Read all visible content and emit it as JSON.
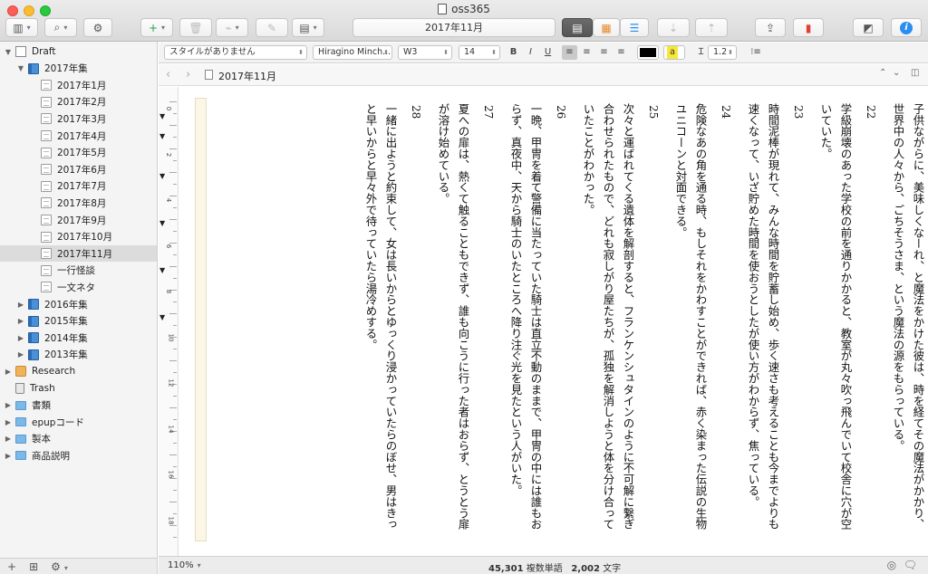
{
  "window": {
    "title": "oss365"
  },
  "toolbar": {
    "document_title": "2017年11月",
    "colors": {
      "selected_view": "#5f5f5f",
      "bookmark": "#e0403a",
      "info": "#2a8ef0"
    }
  },
  "format_bar": {
    "style": "スタイルがありません",
    "font": "Hiragino Minch...",
    "weight": "W3",
    "size": "14",
    "bold": "B",
    "italic": "I",
    "underline": "U",
    "highlight": "a",
    "line_spacing": "1.2",
    "text_color": "#000000",
    "highlight_color": "#f5e83a"
  },
  "path_bar": {
    "title": "2017年11月"
  },
  "binder": {
    "items": [
      {
        "label": "Draft",
        "kind": "draft",
        "level": 0,
        "expanded": true
      },
      {
        "label": "2017年集",
        "kind": "book",
        "level": 1,
        "expanded": true
      },
      {
        "label": "2017年1月",
        "kind": "doc",
        "level": 2
      },
      {
        "label": "2017年2月",
        "kind": "doc",
        "level": 2
      },
      {
        "label": "2017年3月",
        "kind": "doc",
        "level": 2
      },
      {
        "label": "2017年4月",
        "kind": "doc",
        "level": 2
      },
      {
        "label": "2017年5月",
        "kind": "doc",
        "level": 2
      },
      {
        "label": "2017年6月",
        "kind": "doc",
        "level": 2
      },
      {
        "label": "2017年7月",
        "kind": "doc",
        "level": 2
      },
      {
        "label": "2017年8月",
        "kind": "doc",
        "level": 2
      },
      {
        "label": "2017年9月",
        "kind": "doc",
        "level": 2
      },
      {
        "label": "2017年10月",
        "kind": "doc",
        "level": 2
      },
      {
        "label": "2017年11月",
        "kind": "doc",
        "level": 2,
        "selected": true
      },
      {
        "label": "一行怪談",
        "kind": "doc",
        "level": 2
      },
      {
        "label": "一文ネタ",
        "kind": "doc",
        "level": 2
      },
      {
        "label": "2016年集",
        "kind": "book",
        "level": 1,
        "expanded": false
      },
      {
        "label": "2015年集",
        "kind": "book",
        "level": 1,
        "expanded": false
      },
      {
        "label": "2014年集",
        "kind": "book",
        "level": 1,
        "expanded": false
      },
      {
        "label": "2013年集",
        "kind": "book",
        "level": 1,
        "expanded": false
      },
      {
        "label": "Research",
        "kind": "research",
        "level": 0,
        "expanded": false
      },
      {
        "label": "Trash",
        "kind": "trash",
        "level": 0
      },
      {
        "label": "書類",
        "kind": "folder",
        "level": 0,
        "expanded": false
      },
      {
        "label": "epupコード",
        "kind": "folder",
        "level": 0,
        "expanded": false
      },
      {
        "label": "製本",
        "kind": "folder",
        "level": 0,
        "expanded": false
      },
      {
        "label": "商品説明",
        "kind": "folder",
        "level": 0,
        "expanded": false
      }
    ]
  },
  "editor": {
    "columns": [
      {
        "type": "text",
        "text": "子供ながらに、美味しくなーれ、と魔法をかけた彼は、時を経てその魔法がかかり、"
      },
      {
        "type": "text",
        "text": "世界中の人々から、ごちそうさま、という魔法の源をもらっている。"
      },
      {
        "type": "number",
        "text": "22"
      },
      {
        "type": "text",
        "text": "学級崩壊のあった学校の前を通りかかると、教室が丸々吹っ飛んでいて校舎に穴が空"
      },
      {
        "type": "text",
        "text": "いていた。"
      },
      {
        "type": "number",
        "text": "23"
      },
      {
        "type": "text",
        "text": "時間泥棒が現れて、みんな時間を貯蓄し始め、歩く速さも考えることも今までよりも"
      },
      {
        "type": "text",
        "text": "速くなって、いざ貯めた時間を使おうとしたが使い方がわからず、焦っている。"
      },
      {
        "type": "number",
        "text": "24"
      },
      {
        "type": "text",
        "text": "危険なあの角を通る時、もしそれをかわすことができれば、赤く染まった伝説の生物"
      },
      {
        "type": "text",
        "text": "ユニコーンと対面できる。"
      },
      {
        "type": "number",
        "text": "25"
      },
      {
        "type": "text",
        "text": "次々と運ばれてくる遺体を解剖すると、フランケンシュタインのように不可解に繋ぎ"
      },
      {
        "type": "text",
        "text": "合わせられたもので、どれも寂しがり屋たちが、孤独を解消しようと体を分け合って"
      },
      {
        "type": "text",
        "text": "いたことがわかった。"
      },
      {
        "type": "number",
        "text": "26"
      },
      {
        "type": "text",
        "text": "一晩、甲冑を着て警備に当たっていた騎士は直立不動のままで、甲冑の中には誰もお"
      },
      {
        "type": "text",
        "text": "らず、真夜中、天から騎士のいたところへ降り注ぐ光を見たという人がいた。"
      },
      {
        "type": "number",
        "text": "27"
      },
      {
        "type": "text",
        "text": "夏への扉は、熱くて触ることもできず、誰も向こうに行った者はおらず、とうとう扉"
      },
      {
        "type": "text",
        "text": "が溶け始めている。"
      },
      {
        "type": "number",
        "text": "28"
      },
      {
        "type": "text",
        "text": "一緒に出ようと約束して、女は長いからとゆっくり浸かっていたらのぼせ、男はきっ"
      },
      {
        "type": "text",
        "text": "と早いからと早々外で待っていたら湯冷めする。"
      }
    ]
  },
  "ruler": {
    "labels": [
      "0",
      "2",
      "4",
      "6",
      "8",
      "10",
      "12",
      "14",
      "16",
      "18"
    ]
  },
  "status": {
    "zoom": "110%",
    "word_count": "45,301",
    "word_label": "複数単語",
    "char_count": "2,002",
    "char_label": "文字"
  }
}
